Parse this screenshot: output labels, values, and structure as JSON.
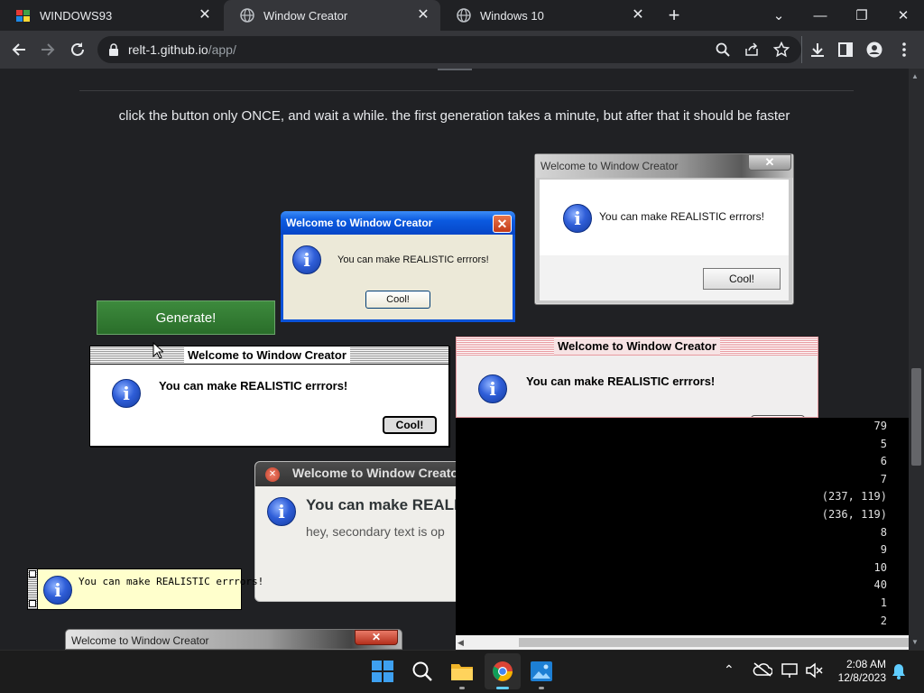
{
  "tabs": [
    {
      "label": "WINDOWS93",
      "active": false
    },
    {
      "label": "Window Creator",
      "active": true
    },
    {
      "label": "Windows 10",
      "active": false
    }
  ],
  "new_tab_symbol": "+",
  "address": {
    "host": "relt-1.github.io",
    "path": "/app/"
  },
  "page": {
    "instruction": "click the button only ONCE, and wait a while. the first generation takes a minute, but after that it should be faster",
    "generate_label": "Generate!"
  },
  "dialogs": {
    "title": "Welcome to Window Creator",
    "message": "You can make REALISTIC errrors!",
    "ok_label": "Cool!",
    "secondary_text": "hey, secondary text is op"
  },
  "console": {
    "lines": [
      "79",
      "5",
      "6",
      "7",
      "(237, 119)",
      "(236, 119)",
      "8",
      "9",
      "10",
      "40",
      "1",
      "2"
    ]
  },
  "taskbar": {
    "time": "2:08 AM",
    "date": "12/8/2023"
  },
  "icons": [
    "back-icon",
    "forward-icon",
    "reload-icon",
    "lock-icon",
    "search-icon",
    "share-icon",
    "star-icon",
    "download-icon",
    "sidebar-icon",
    "profile-icon",
    "menu-icon",
    "windows-start-icon",
    "search-taskbar-icon",
    "file-explorer-icon",
    "chrome-icon",
    "photos-icon",
    "info-icon",
    "bell-icon"
  ]
}
